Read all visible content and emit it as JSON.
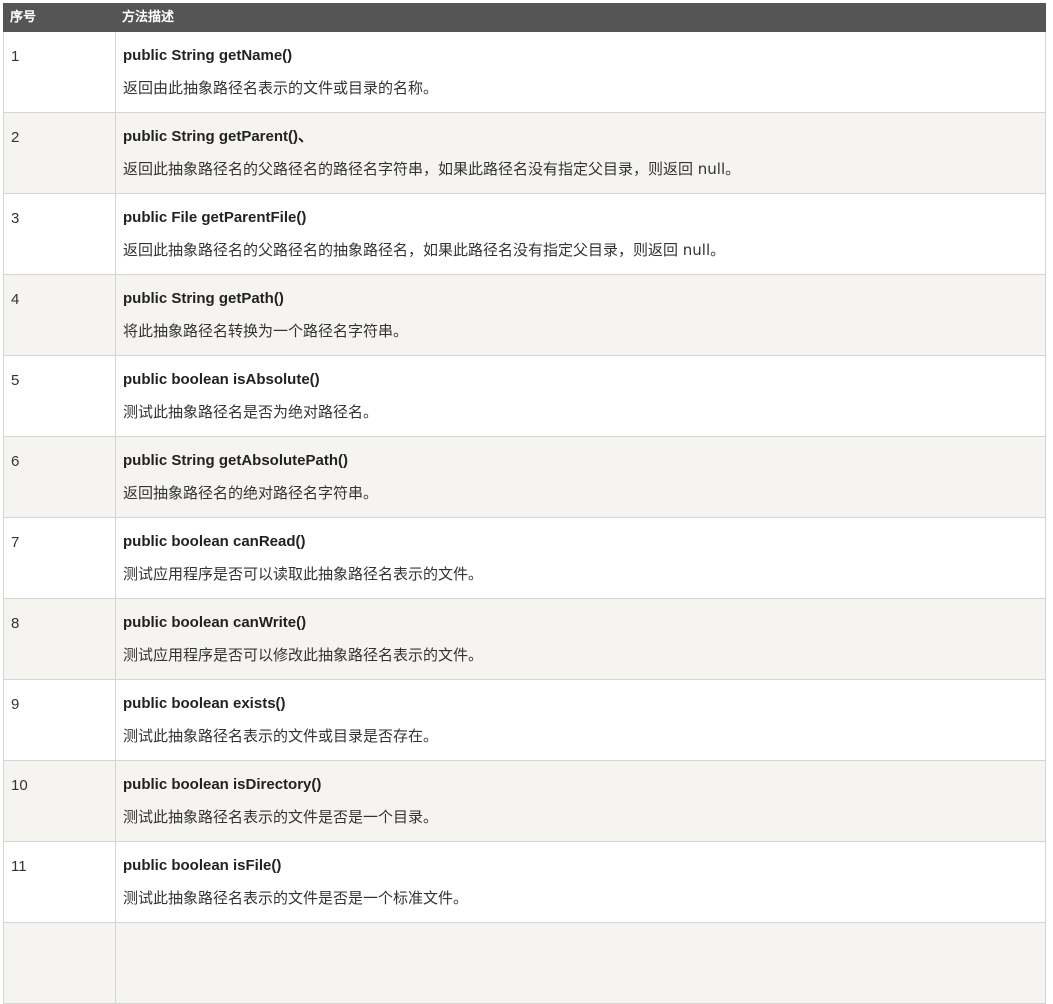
{
  "header": {
    "col_no": "序号",
    "col_method": "方法描述"
  },
  "rows": [
    {
      "no": "1",
      "method": "public String getName()",
      "desc": "返回由此抽象路径名表示的文件或目录的名称。"
    },
    {
      "no": "2",
      "method": "public String getParent()、",
      "desc": " 返回此抽象路径名的父路径名的路径名字符串，如果此路径名没有指定父目录，则返回 null。"
    },
    {
      "no": "3",
      "method": "public File getParentFile()",
      "desc": "返回此抽象路径名的父路径名的抽象路径名，如果此路径名没有指定父目录，则返回 null。"
    },
    {
      "no": "4",
      "method": "public String getPath()",
      "desc": "将此抽象路径名转换为一个路径名字符串。"
    },
    {
      "no": "5",
      "method": "public boolean isAbsolute()",
      "desc": "测试此抽象路径名是否为绝对路径名。"
    },
    {
      "no": "6",
      "method": "public String getAbsolutePath()",
      "desc": "返回抽象路径名的绝对路径名字符串。"
    },
    {
      "no": "7",
      "method": "public boolean canRead()",
      "desc": "测试应用程序是否可以读取此抽象路径名表示的文件。"
    },
    {
      "no": "8",
      "method": "public boolean canWrite()",
      "desc": "测试应用程序是否可以修改此抽象路径名表示的文件。"
    },
    {
      "no": "9",
      "method": "public boolean exists()",
      "desc": "测试此抽象路径名表示的文件或目录是否存在。"
    },
    {
      "no": "10",
      "method": "public boolean isDirectory()",
      "desc": "测试此抽象路径名表示的文件是否是一个目录。"
    },
    {
      "no": "11",
      "method": "public boolean isFile()",
      "desc": "测试此抽象路径名表示的文件是否是一个标准文件。"
    }
  ]
}
